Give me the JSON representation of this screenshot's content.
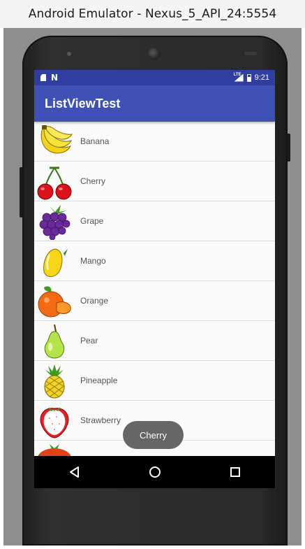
{
  "window": {
    "title": "Android Emulator - Nexus_5_API_24:5554"
  },
  "status_bar": {
    "left_icons": [
      "sd-card-icon",
      "notification-n-icon"
    ],
    "right_icons": [
      "signal-icon",
      "battery-icon"
    ],
    "signal_badge": "LTE",
    "time": "9:21",
    "color": "#303f9f"
  },
  "app_bar": {
    "title": "ListViewTest",
    "color": "#3f51b5"
  },
  "list": {
    "items": [
      {
        "label": "Banana",
        "icon": "banana-icon"
      },
      {
        "label": "Cherry",
        "icon": "cherry-icon"
      },
      {
        "label": "Grape",
        "icon": "grape-icon"
      },
      {
        "label": "Mango",
        "icon": "mango-icon"
      },
      {
        "label": "Orange",
        "icon": "orange-icon"
      },
      {
        "label": "Pear",
        "icon": "pear-icon"
      },
      {
        "label": "Pineapple",
        "icon": "pineapple-icon"
      },
      {
        "label": "Strawberry",
        "icon": "strawberry-icon"
      },
      {
        "label": "",
        "icon": "watermelon-icon"
      }
    ]
  },
  "toast": {
    "text": "Cherry"
  },
  "nav_bar": {
    "buttons": [
      {
        "icon": "back-triangle-icon"
      },
      {
        "icon": "home-circle-icon"
      },
      {
        "icon": "recents-square-icon"
      }
    ]
  }
}
